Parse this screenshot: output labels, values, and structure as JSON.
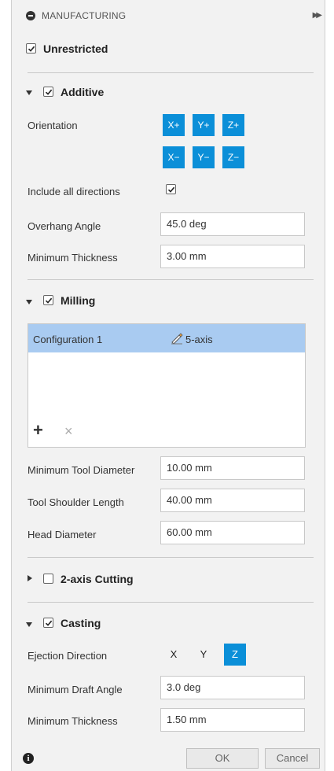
{
  "header": {
    "title": "MANUFACTURING"
  },
  "unrestricted": {
    "label": "Unrestricted",
    "checked": true
  },
  "additive": {
    "label": "Additive",
    "checked": true,
    "orientation_label": "Orientation",
    "axes_top": [
      "X+",
      "Y+",
      "Z+"
    ],
    "axes_bottom": [
      "X−",
      "Y−",
      "Z−"
    ],
    "include_all_label": "Include all directions",
    "include_all_checked": true,
    "overhang_label": "Overhang Angle",
    "overhang_value": "45.0 deg",
    "min_thickness_label": "Minimum Thickness",
    "min_thickness_value": "3.00 mm"
  },
  "milling": {
    "label": "Milling",
    "checked": true,
    "configs": [
      {
        "name": "Configuration 1",
        "type": "5-axis"
      }
    ],
    "add_icon": "+",
    "remove_icon": "×",
    "min_tool_label": "Minimum Tool Diameter",
    "min_tool_value": "10.00 mm",
    "shoulder_label": "Tool Shoulder Length",
    "shoulder_value": "40.00 mm",
    "head_label": "Head Diameter",
    "head_value": "60.00 mm"
  },
  "cutting": {
    "label": "2-axis Cutting",
    "checked": false
  },
  "casting": {
    "label": "Casting",
    "checked": true,
    "ejection_label": "Ejection Direction",
    "ejection_options": [
      "X",
      "Y",
      "Z"
    ],
    "ejection_selected": "Z",
    "draft_label": "Minimum Draft Angle",
    "draft_value": "3.0 deg",
    "thickness_label": "Minimum Thickness",
    "thickness_value": "1.50 mm"
  },
  "footer": {
    "ok_label": "OK",
    "cancel_label": "Cancel"
  },
  "colors": {
    "accent": "#0b8fd8",
    "selection": "#a9cbf1"
  }
}
